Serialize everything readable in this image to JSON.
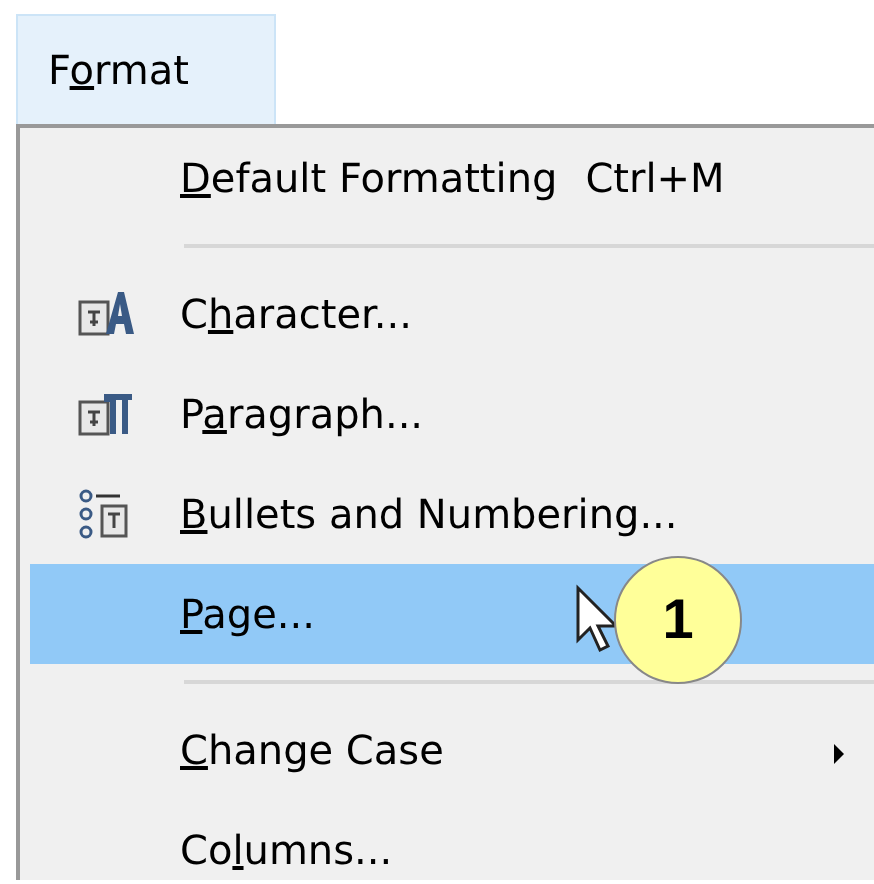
{
  "menu_bar": {
    "title": {
      "pre": "F",
      "key": "o",
      "post": "rmat"
    },
    "open": true
  },
  "menu": {
    "items": [
      {
        "kind": "item",
        "label": {
          "key": "D",
          "post": "efault Formatting"
        },
        "shortcut": "Ctrl+M",
        "selected": false,
        "submenu": false
      },
      {
        "kind": "separator"
      },
      {
        "kind": "item",
        "label": {
          "pre": "C",
          "key": "h",
          "post": "aracter..."
        },
        "selected": false,
        "submenu": false
      },
      {
        "kind": "item",
        "label": {
          "pre": "P",
          "key": "a",
          "post": "ragraph..."
        },
        "selected": false,
        "submenu": false
      },
      {
        "kind": "item",
        "label": {
          "key": "B",
          "post": "ullets and Numbering..."
        },
        "selected": false,
        "submenu": false
      },
      {
        "kind": "item",
        "label": {
          "key": "P",
          "post": "age..."
        },
        "selected": true,
        "submenu": false
      },
      {
        "kind": "separator"
      },
      {
        "kind": "item",
        "label": {
          "key": "C",
          "post": "hange Case"
        },
        "selected": false,
        "submenu": true
      },
      {
        "kind": "item",
        "label": {
          "pre": "Co",
          "key": "l",
          "post": "umns..."
        },
        "selected": false,
        "submenu": false
      }
    ]
  },
  "callout": {
    "number": "1"
  }
}
